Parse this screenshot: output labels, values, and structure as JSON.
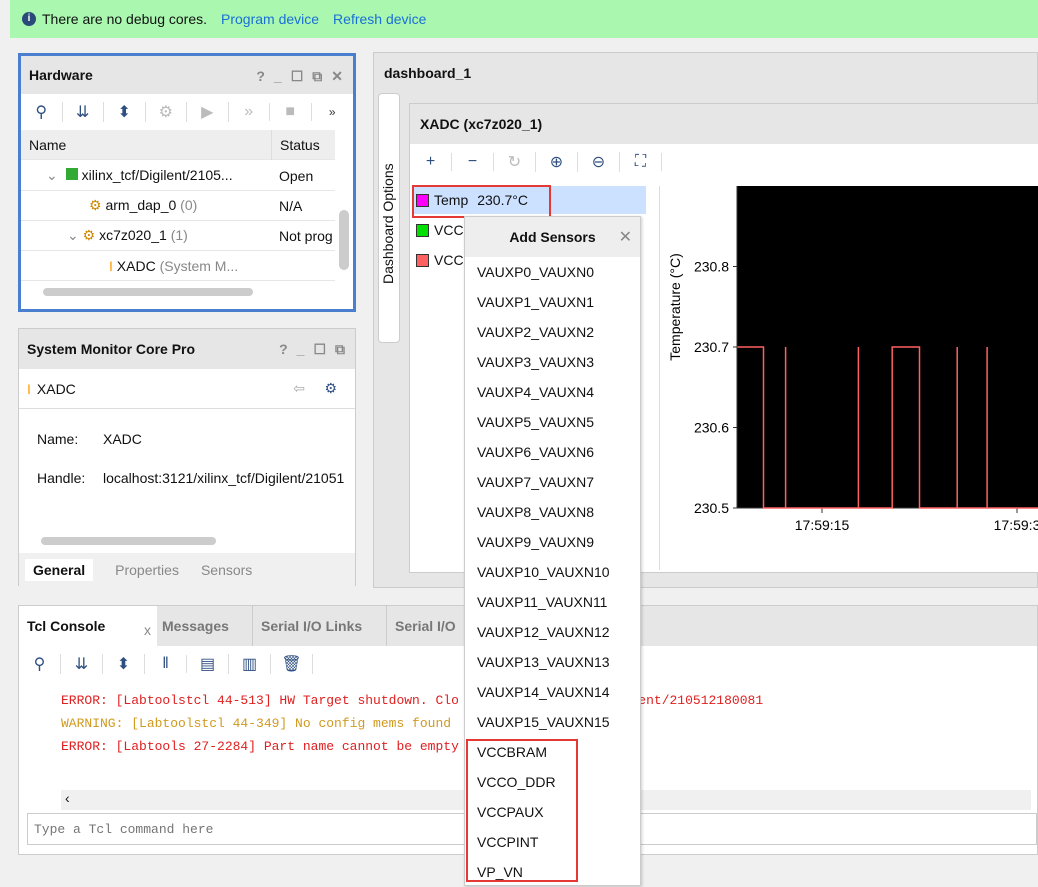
{
  "banner": {
    "message": "There are no debug cores.",
    "program": "Program device",
    "refresh": "Refresh device"
  },
  "hardware": {
    "title": "Hardware",
    "col_name": "Name",
    "col_status": "Status",
    "rows": [
      {
        "name": "xilinx_tcf/Digilent/2105...",
        "extra": "",
        "status": "Open"
      },
      {
        "name": "arm_dap_0",
        "extra": "(0)",
        "status": "N/A"
      },
      {
        "name": "xc7z020_1",
        "extra": "(1)",
        "status": "Not prog"
      },
      {
        "name": "XADC",
        "extra": "(System M...",
        "status": ""
      }
    ]
  },
  "props": {
    "title": "System Monitor Core Pro",
    "object": "XADC",
    "name_label": "Name:",
    "name_value": "XADC",
    "handle_label": "Handle:",
    "handle_value": "localhost:3121/xilinx_tcf/Digilent/21051",
    "tabs": [
      "General",
      "Properties",
      "Sensors"
    ]
  },
  "dashboard": {
    "title": "dashboard_1",
    "side_tab": "Dashboard Options",
    "xadc_title": "XADC (xc7z020_1)",
    "sensors": [
      {
        "name": "Temp",
        "value": "230.7°C",
        "color": "#ff00ff"
      },
      {
        "name": "VCC",
        "value": "",
        "color": "#00e000"
      },
      {
        "name": "VCC",
        "value": "",
        "color": "#ff6060"
      }
    ]
  },
  "add_sensors": {
    "title": "Add Sensors",
    "items": [
      "VAUXP0_VAUXN0",
      "VAUXP1_VAUXN1",
      "VAUXP2_VAUXN2",
      "VAUXP3_VAUXN3",
      "VAUXP4_VAUXN4",
      "VAUXP5_VAUXN5",
      "VAUXP6_VAUXN6",
      "VAUXP7_VAUXN7",
      "VAUXP8_VAUXN8",
      "VAUXP9_VAUXN9",
      "VAUXP10_VAUXN10",
      "VAUXP11_VAUXN11",
      "VAUXP12_VAUXN12",
      "VAUXP13_VAUXN13",
      "VAUXP14_VAUXN14",
      "VAUXP15_VAUXN15",
      "VCCBRAM",
      "VCCO_DDR",
      "VCCPAUX",
      "VCCPINT",
      "VP_VN"
    ]
  },
  "chart_data": {
    "type": "line",
    "ylabel": "Temperature (°C)",
    "ylim": [
      230.5,
      230.9
    ],
    "yticks": [
      "230.8",
      "230.7",
      "230.6",
      "230.5"
    ],
    "xticks": [
      "17:59:15",
      "17:59:3"
    ],
    "background": "#000000",
    "line_color": "#ff6060",
    "points": [
      [
        "17:59:08.5",
        230.7
      ],
      [
        "17:59:10.5",
        230.7
      ],
      [
        "17:59:10.5",
        230.5
      ],
      [
        "17:59:12.2",
        230.5
      ],
      [
        "17:59:12.2",
        230.7
      ],
      [
        "17:59:12.2",
        230.5
      ],
      [
        "17:59:17.8",
        230.5
      ],
      [
        "17:59:17.8",
        230.7
      ],
      [
        "17:59:17.8",
        230.5
      ],
      [
        "17:59:20.4",
        230.5
      ],
      [
        "17:59:20.4",
        230.7
      ],
      [
        "17:59:22.5",
        230.7
      ],
      [
        "17:59:22.5",
        230.5
      ],
      [
        "17:59:25.4",
        230.5
      ],
      [
        "17:59:25.4",
        230.7
      ],
      [
        "17:59:25.4",
        230.5
      ],
      [
        "17:59:27.7",
        230.5
      ],
      [
        "17:59:27.7",
        230.7
      ],
      [
        "17:59:27.7",
        230.5
      ],
      [
        "17:59:32",
        230.5
      ]
    ]
  },
  "console": {
    "tabs": [
      "Tcl Console",
      "Messages",
      "Serial I/O Links",
      "Serial I/O"
    ],
    "lines": [
      {
        "text": "ERROR: [Labtoolstcl 44-513] HW Target shutdown. Clo                          :3121/xilinx_tcf/Digilent/210512180081",
        "color": "#e02020"
      },
      {
        "text": "WARNING: [Labtoolstcl 44-349] No config mems found",
        "color": "#d09a20"
      },
      {
        "text": "ERROR: [Labtools 27-2284] Part name cannot be empty",
        "color": "#e02020"
      }
    ],
    "placeholder": "Type a Tcl command here"
  }
}
